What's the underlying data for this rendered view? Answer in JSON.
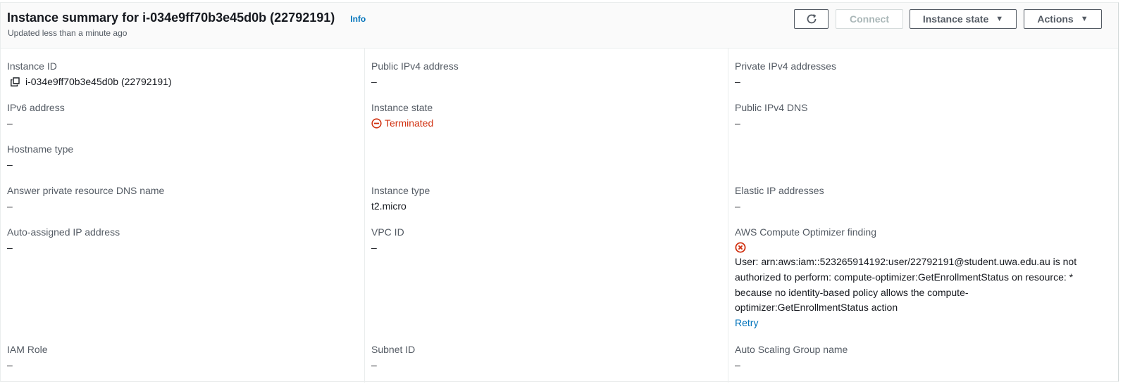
{
  "header": {
    "title": "Instance summary for i-034e9ff70b3e45d0b (22792191)",
    "info_label": "Info",
    "updated": "Updated less than a minute ago",
    "buttons": {
      "refresh_icon": "refresh-icon",
      "connect": "Connect",
      "instance_state": "Instance state",
      "actions": "Actions"
    }
  },
  "details": {
    "instance_id": {
      "label": "Instance ID",
      "value": "i-034e9ff70b3e45d0b (22792191)",
      "icon": "copy-icon"
    },
    "public_ipv4": {
      "label": "Public IPv4 address",
      "value": "–"
    },
    "private_ipv4": {
      "label": "Private IPv4 addresses",
      "value": "–"
    },
    "ipv6": {
      "label": "IPv6 address",
      "value": "–"
    },
    "instance_state": {
      "label": "Instance state",
      "value": "Terminated",
      "icon": "minus-circle-icon",
      "color": "#d13212"
    },
    "public_dns": {
      "label": "Public IPv4 DNS",
      "value": "–"
    },
    "hostname_type": {
      "label": "Hostname type",
      "value": "–"
    },
    "answer_dns": {
      "label": "Answer private resource DNS name",
      "value": "–"
    },
    "instance_type": {
      "label": "Instance type",
      "value": "t2.micro"
    },
    "elastic_ip": {
      "label": "Elastic IP addresses",
      "value": "–"
    },
    "auto_ip": {
      "label": "Auto-assigned IP address",
      "value": "–"
    },
    "vpc_id": {
      "label": "VPC ID",
      "value": "–"
    },
    "optimizer": {
      "label": "AWS Compute Optimizer finding",
      "icon": "error-x-icon",
      "message": "User: arn:aws:iam::523265914192:user/22792191@student.uwa.edu.au is not authorized to perform: compute-optimizer:GetEnrollmentStatus on resource: * because no identity-based policy allows the compute-optimizer:GetEnrollmentStatus action",
      "retry": "Retry"
    },
    "iam_role": {
      "label": "IAM Role",
      "value": "–"
    },
    "subnet_id": {
      "label": "Subnet ID",
      "value": "–"
    },
    "asg_name": {
      "label": "Auto Scaling Group name",
      "value": "–"
    }
  }
}
